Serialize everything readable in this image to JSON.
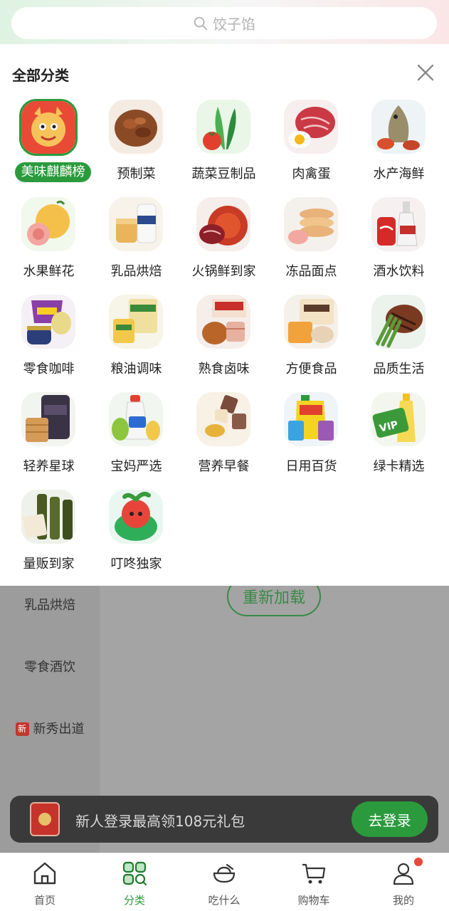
{
  "search": {
    "placeholder": "饺子馅"
  },
  "panel": {
    "title": "全部分类",
    "categories": [
      {
        "label": "美味麒麟榜",
        "icon": "dragon-mascot",
        "selected": true
      },
      {
        "label": "预制菜",
        "icon": "braised-dish"
      },
      {
        "label": "蔬菜豆制品",
        "icon": "vegetables"
      },
      {
        "label": "肉禽蛋",
        "icon": "meat-egg"
      },
      {
        "label": "水产海鲜",
        "icon": "seafood"
      },
      {
        "label": "水果鲜花",
        "icon": "fruit-flower"
      },
      {
        "label": "乳品烘焙",
        "icon": "dairy-bakery"
      },
      {
        "label": "火锅鲜到家",
        "icon": "hotpot"
      },
      {
        "label": "冻品面点",
        "icon": "frozen-pastry"
      },
      {
        "label": "酒水饮料",
        "icon": "drinks"
      },
      {
        "label": "零食咖啡",
        "icon": "snack-coffee"
      },
      {
        "label": "粮油调味",
        "icon": "grain-oil"
      },
      {
        "label": "熟食卤味",
        "icon": "deli"
      },
      {
        "label": "方便食品",
        "icon": "instant-food"
      },
      {
        "label": "品质生活",
        "icon": "quality-steak"
      },
      {
        "label": "轻养星球",
        "icon": "light-health"
      },
      {
        "label": "宝妈严选",
        "icon": "baby-food"
      },
      {
        "label": "营养早餐",
        "icon": "breakfast"
      },
      {
        "label": "日用百货",
        "icon": "daily-goods"
      },
      {
        "label": "绿卡精选",
        "icon": "vip-card"
      },
      {
        "label": "量贩到家",
        "icon": "bulk-oil"
      },
      {
        "label": "叮咚独家",
        "icon": "dingdong-mascot"
      }
    ]
  },
  "underlay": {
    "reload_label": "重新加载",
    "side_items": [
      {
        "label": "乳品烘焙"
      },
      {
        "label": "零食酒饮"
      },
      {
        "label": "新秀出道",
        "tag": "新"
      }
    ]
  },
  "login_banner": {
    "text": "新人登录最高领108元礼包",
    "button": "去登录"
  },
  "tabbar": {
    "tabs": [
      {
        "label": "首页",
        "icon": "home-icon"
      },
      {
        "label": "分类",
        "icon": "category-icon",
        "active": true
      },
      {
        "label": "吃什么",
        "icon": "bowl-icon"
      },
      {
        "label": "购物车",
        "icon": "cart-icon"
      },
      {
        "label": "我的",
        "icon": "profile-icon",
        "badge_dot": true
      }
    ]
  },
  "colors": {
    "accent": "#2b9a3d",
    "badge": "#e8473a"
  }
}
